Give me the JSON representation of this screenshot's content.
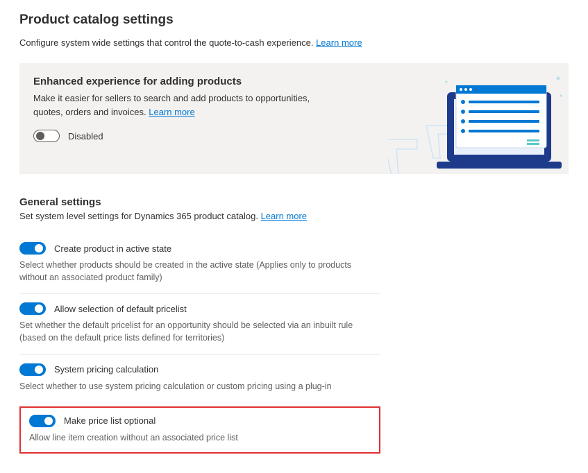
{
  "header": {
    "title": "Product catalog settings",
    "subtitle": "Configure system wide settings that control the quote-to-cash experience.",
    "learn_more": "Learn more"
  },
  "banner": {
    "title": "Enhanced experience for adding products",
    "desc": "Make it easier for sellers to search and add products to opportunities, quotes, orders and invoices.",
    "learn_more": "Learn more",
    "toggle_label": "Disabled",
    "toggle_on": false
  },
  "general": {
    "title": "General settings",
    "sub": "Set system level settings for Dynamics 365 product catalog.",
    "learn_more": "Learn more",
    "settings": [
      {
        "label": "Create product in active state",
        "desc": "Select whether products should be created in the active state (Applies only to products without an associated product family)",
        "on": true
      },
      {
        "label": "Allow selection of default pricelist",
        "desc": "Set whether the default pricelist for an opportunity should be selected via an inbuilt rule (based on the default price lists defined for territories)",
        "on": true
      },
      {
        "label": "System pricing calculation",
        "desc": "Select whether to use system pricing calculation or custom pricing using a plug-in",
        "on": true
      },
      {
        "label": "Make price list optional",
        "desc": "Allow line item creation without an associated price list",
        "on": true,
        "highlighted": true
      }
    ]
  }
}
